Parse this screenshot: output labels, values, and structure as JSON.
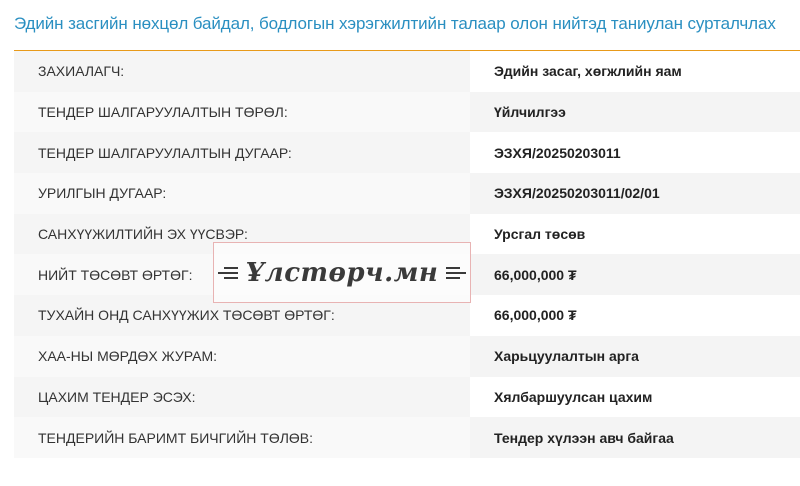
{
  "page": {
    "title": "Эдийн засгийн нөхцөл байдал, бодлогын хэрэгжилтийн талаар олон нийтэд таниулан сурталчлах"
  },
  "details": {
    "rows": [
      {
        "label": "ЗАХИАЛАГЧ:",
        "value": "Эдийн засаг, хөгжлийн яам"
      },
      {
        "label": "ТЕНДЕР ШАЛГАРУУЛАЛТЫН ТӨРӨЛ:",
        "value": "Үйлчилгээ"
      },
      {
        "label": "ТЕНДЕР ШАЛГАРУУЛАЛТЫН ДУГААР:",
        "value": "ЭЗХЯ/20250203011"
      },
      {
        "label": "УРИЛГЫН ДУГААР:",
        "value": "ЭЗХЯ/20250203011/02/01"
      },
      {
        "label": "САНХҮҮЖИЛТИЙН ЭХ ҮҮСВЭР:",
        "value": "Урсгал төсөв"
      },
      {
        "label": "НИЙТ ТӨСӨВТ ӨРТӨГ:",
        "value": "66,000,000 ₮"
      },
      {
        "label": "ТУХАЙН ОНД САНХҮҮЖИХ ТӨСӨВТ ӨРТӨГ:",
        "value": "66,000,000 ₮"
      },
      {
        "label": "ХАА-НЫ МӨРДӨХ ЖУРАМ:",
        "value": "Харьцуулалтын арга"
      },
      {
        "label": "ЦАХИМ ТЕНДЕР ЭСЭХ:",
        "value": "Хялбаршуулсан цахим"
      },
      {
        "label": "ТЕНДЕРИЙН БАРИМТ БИЧГИЙН ТӨЛӨВ:",
        "value": "Тендер хүлээн авч байгаа"
      }
    ]
  },
  "watermark": {
    "text": "Ұлстөрч.мн"
  }
}
